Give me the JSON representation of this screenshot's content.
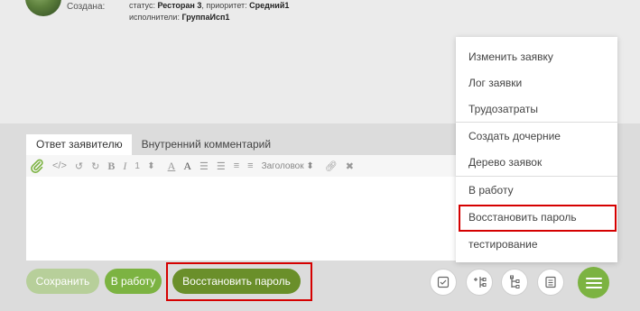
{
  "ticket": {
    "created_label": "Создана:",
    "status_prefix": "статус: ",
    "status_value": "Ресторан 3",
    "priority_prefix": ", приоритет: ",
    "priority_value": "Средний1",
    "executors_prefix": "исполнители: ",
    "executors_value": "ГруппаИсп1"
  },
  "tabs": [
    {
      "label": "Ответ заявителю",
      "active": true
    },
    {
      "label": "Внутренний комментарий",
      "active": false
    }
  ],
  "toolbar": {
    "font_size_value": "1",
    "heading_select": "Заголовок"
  },
  "buttons": {
    "save": "Сохранить",
    "to_work": "В работу",
    "restore_password": "Восстановить пароль"
  },
  "menu": {
    "items": [
      "Изменить заявку",
      "Лог заявки",
      "Трудозатраты",
      "Создать дочерние",
      "Дерево заявок",
      "В работу",
      "Восстановить пароль",
      "тестирование"
    ]
  },
  "colors": {
    "accent_green": "#7cb342",
    "dark_green": "#6a8f2a",
    "highlight_red": "#d50000"
  }
}
